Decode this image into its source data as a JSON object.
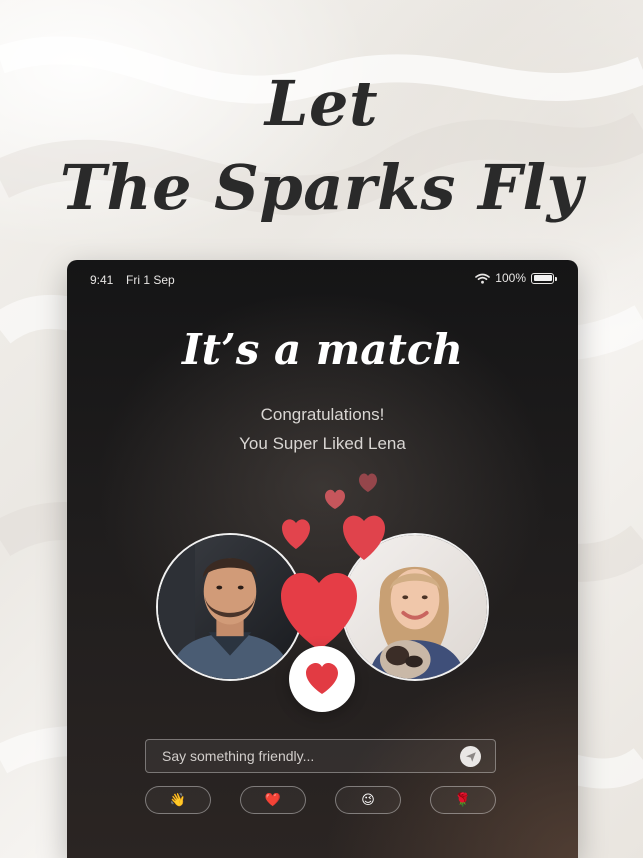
{
  "headline": {
    "line1": "Let",
    "line2": "The Sparks Fly"
  },
  "status_bar": {
    "time": "9:41",
    "date": "Fri 1 Sep",
    "battery_label": "100%",
    "battery_level": 1.0
  },
  "match": {
    "title": "It’s a match",
    "congrats": "Congratulations!",
    "subtitle": "You Super Liked Lena"
  },
  "message": {
    "placeholder": "Say something friendly..."
  },
  "quick_reactions": [
    {
      "emoji": "👋",
      "icon": "waving-hand-icon"
    },
    {
      "emoji": "❤️",
      "icon": "red-heart-icon"
    },
    {
      "emoji": "😉",
      "icon": "winking-face-icon"
    },
    {
      "emoji": "🌹",
      "icon": "rose-icon"
    }
  ],
  "colors": {
    "accent_red": "#e23b43",
    "heart_button_bg": "#ffffff",
    "device_bg": "#151516",
    "headline_text": "#2a2a2a"
  }
}
